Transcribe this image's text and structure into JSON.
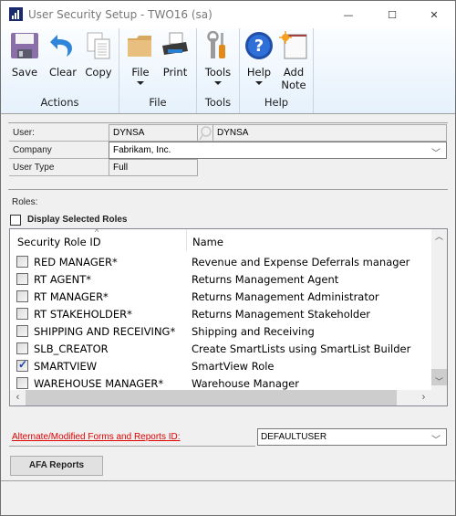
{
  "window": {
    "title": "User Security Setup  -  TWO16 (sa)",
    "controls": {
      "minimize": "—",
      "maximize": "☐",
      "close": "✕"
    }
  },
  "ribbon": {
    "groups": [
      {
        "label": "Actions",
        "buttons": [
          {
            "label": "Save",
            "icon": "save-icon"
          },
          {
            "label": "Clear",
            "icon": "undo-icon"
          },
          {
            "label": "Copy",
            "icon": "copy-icon"
          }
        ]
      },
      {
        "label": "File",
        "buttons": [
          {
            "label": "File",
            "icon": "folder-icon",
            "dropdown": true
          },
          {
            "label": "Print",
            "icon": "printer-icon"
          }
        ]
      },
      {
        "label": "Tools",
        "buttons": [
          {
            "label": "Tools",
            "icon": "tools-icon",
            "dropdown": true
          }
        ]
      },
      {
        "label": "Help",
        "buttons": [
          {
            "label": "Help",
            "icon": "help-icon",
            "dropdown": true
          },
          {
            "label": "Add Note",
            "label_line1": "Add",
            "label_line2": "Note",
            "icon": "note-icon"
          }
        ]
      }
    ]
  },
  "header": {
    "user_label": "User:",
    "user_id": "DYNSA",
    "user_name": "DYNSA",
    "company_label": "Company",
    "company_value": "Fabrikam, Inc.",
    "user_type_label": "User Type",
    "user_type_value": "Full"
  },
  "roles": {
    "label": "Roles:",
    "display_selected_label": "Display Selected Roles",
    "display_selected_checked": false,
    "columns": [
      "Security Role ID",
      "Name"
    ],
    "rows": [
      {
        "id": "RED MANAGER*",
        "name": "Revenue and Expense Deferrals manager",
        "checked": false
      },
      {
        "id": "RT AGENT*",
        "name": "Returns Management Agent",
        "checked": false
      },
      {
        "id": "RT MANAGER*",
        "name": "Returns Management Administrator",
        "checked": false
      },
      {
        "id": "RT STAKEHOLDER*",
        "name": "Returns Management Stakeholder",
        "checked": false
      },
      {
        "id": "SHIPPING AND RECEIVING*",
        "name": "Shipping and Receiving",
        "checked": false
      },
      {
        "id": "SLB_CREATOR",
        "name": "Create SmartLists using SmartList Builder",
        "checked": false
      },
      {
        "id": "SMARTVIEW",
        "name": "SmartView Role",
        "checked": true
      },
      {
        "id": "WAREHOUSE MANAGER*",
        "name": "Warehouse Manager",
        "checked": false
      }
    ]
  },
  "alternate": {
    "link_label": "Alternate/Modified Forms and Reports ID:",
    "value": "DEFAULTUSER"
  },
  "afa_button_label": "AFA Reports",
  "colors": {
    "link_red": "#e00000",
    "ribbon_top": "#fbfdff",
    "ribbon_bottom": "#e5f1fc",
    "check_blue": "#1b3fa8"
  }
}
